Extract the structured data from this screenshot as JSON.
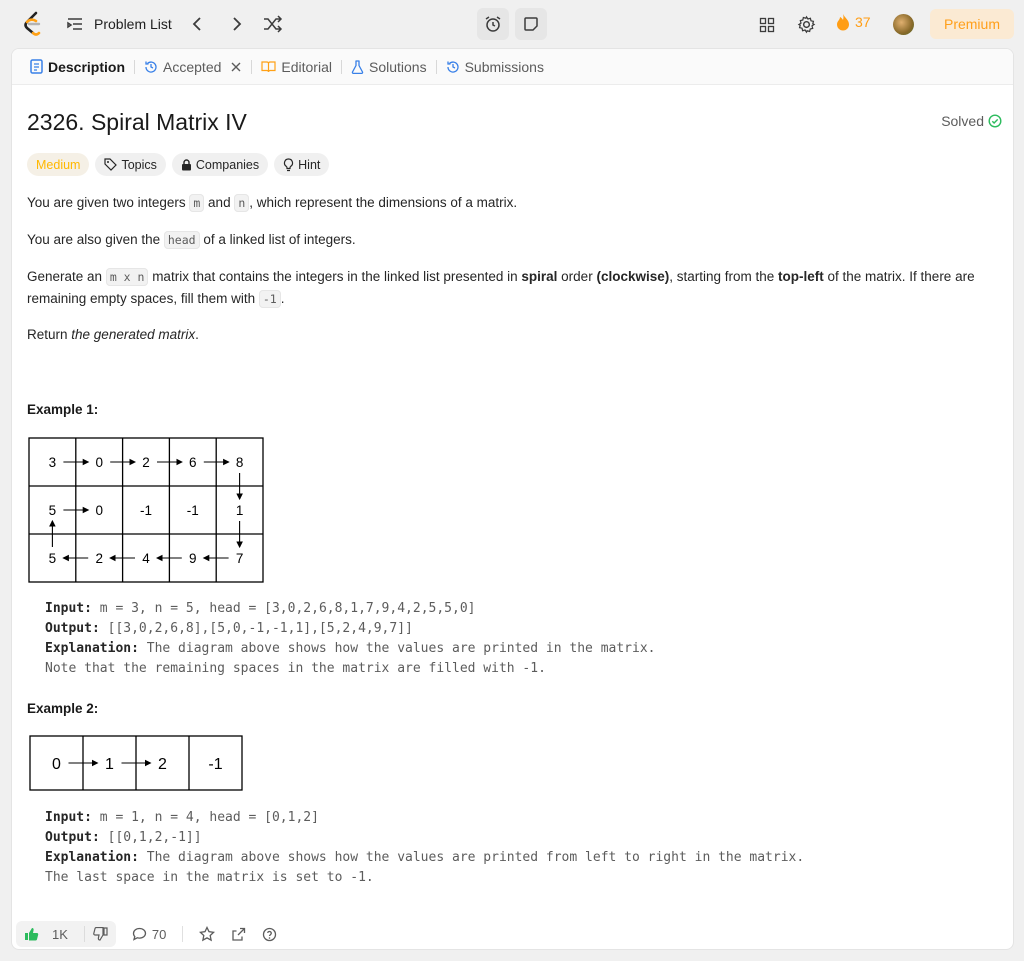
{
  "nav": {
    "problem_list": "Problem List",
    "streak": "37",
    "premium": "Premium"
  },
  "tabs": [
    {
      "label": "Description"
    },
    {
      "label": "Accepted"
    },
    {
      "label": "Editorial"
    },
    {
      "label": "Solutions"
    },
    {
      "label": "Submissions"
    }
  ],
  "problem": {
    "title": "2326. Spiral Matrix IV",
    "status": "Solved",
    "difficulty": "Medium",
    "tags": [
      "Topics",
      "Companies",
      "Hint"
    ],
    "p1_a": "You are given two integers ",
    "p1_m": "m",
    "p1_b": " and ",
    "p1_n": "n",
    "p1_c": ", which represent the dimensions of a matrix.",
    "p2_a": "You are also given the ",
    "p2_head": "head",
    "p2_b": " of a linked list of integers.",
    "p3_a": "Generate an ",
    "p3_mn": "m x n",
    "p3_b": " matrix that contains the integers in the linked list presented in ",
    "p3_spiral": "spiral",
    "p3_c": " order ",
    "p3_cw": "(clockwise)",
    "p3_d": ", starting from the ",
    "p3_tl": "top-left",
    "p3_e": " of the matrix. If there are remaining empty spaces, fill them with ",
    "p3_neg": "-1",
    "p3_f": ".",
    "p4_a": "Return ",
    "p4_b": "the generated matrix",
    "p4_c": "."
  },
  "example1": {
    "heading": "Example 1:",
    "grid": [
      [
        "3",
        "0",
        "2",
        "6",
        "8"
      ],
      [
        "5",
        "0",
        "-1",
        "-1",
        "1"
      ],
      [
        "5",
        "2",
        "4",
        "9",
        "7"
      ]
    ],
    "input_label": "Input:",
    "input": " m = 3, n = 5, head = [3,0,2,6,8,1,7,9,4,2,5,5,0]",
    "output_label": "Output:",
    "output": " [[3,0,2,6,8],[5,0,-1,-1,1],[5,2,4,9,7]]",
    "expl_label": "Explanation:",
    "expl1": " The diagram above shows how the values are printed in the matrix.",
    "expl2": "Note that the remaining spaces in the matrix are filled with -1."
  },
  "example2": {
    "heading": "Example 2:",
    "grid": [
      [
        "0",
        "1",
        "2",
        "-1"
      ]
    ],
    "input_label": "Input:",
    "input": " m = 1, n = 4, head = [0,1,2]",
    "output_label": "Output:",
    "output": " [[0,1,2,-1]]",
    "expl_label": "Explanation:",
    "expl1": " The diagram above shows how the values are printed from left to right in the matrix.",
    "expl2": "The last space in the matrix is set to -1."
  },
  "footer": {
    "likes": "1K",
    "comments": "70"
  },
  "colors": {
    "accent": "#ffa116",
    "medium": "#ffb800",
    "solved": "#2cbb5d",
    "like": "#2cbb5d"
  }
}
